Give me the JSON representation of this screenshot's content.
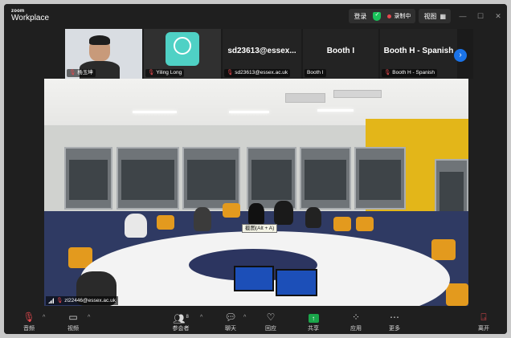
{
  "app": {
    "brand_top": "zoom",
    "brand_bottom": "Workplace"
  },
  "titlebar": {
    "login": "登录",
    "recording": "录制中",
    "view": "视图",
    "minimize": "—",
    "maximize": "☐",
    "close": "✕"
  },
  "participants": [
    {
      "name": "杨玉坤",
      "muted": true
    },
    {
      "name": "Yiling Long",
      "muted": true
    },
    {
      "title": "sd23613@essex...",
      "name": "sd23613@essex.ac.uk",
      "muted": true
    },
    {
      "title": "Booth I",
      "name": "Booth I",
      "muted": false
    },
    {
      "title": "Booth H - Spanish",
      "name": "Booth H - Spanish",
      "muted": true
    }
  ],
  "video": {
    "speaker_name": "zl22446@essex.ac.uk",
    "tooltip": "截图(Alt + A)"
  },
  "toolbar": {
    "audio": "音频",
    "video": "视频",
    "participants": "参会者",
    "participants_count": "8",
    "chat": "聊天",
    "reactions": "回应",
    "share": "共享",
    "apps": "应用",
    "more": "更多",
    "leave": "离开"
  },
  "colors": {
    "accent": "#1a73e8",
    "share": "#1aa64a",
    "danger": "#e5484d",
    "secure": "#19c25a"
  }
}
